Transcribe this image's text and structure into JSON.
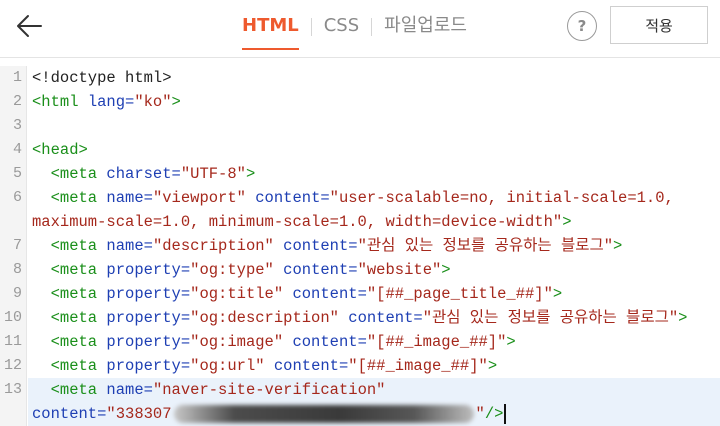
{
  "toolbar": {
    "tabs": [
      {
        "label": "HTML",
        "active": true
      },
      {
        "label": "CSS",
        "active": false
      },
      {
        "label": "파일업로드",
        "active": false
      }
    ],
    "help_label": "?",
    "apply_label": "적용",
    "accent_color": "#ee5a2e"
  },
  "editor": {
    "lines": [
      {
        "num": "1",
        "tokens": [
          {
            "t": "plain",
            "v": "<!doctype html>"
          }
        ]
      },
      {
        "num": "2",
        "tokens": [
          {
            "t": "tag",
            "v": "<html "
          },
          {
            "t": "attr",
            "v": "lang="
          },
          {
            "t": "str",
            "v": "\"ko\""
          },
          {
            "t": "tag",
            "v": ">"
          }
        ]
      },
      {
        "num": "3",
        "tokens": []
      },
      {
        "num": "4",
        "tokens": [
          {
            "t": "tag",
            "v": "<head>"
          }
        ]
      },
      {
        "num": "5",
        "tokens": [
          {
            "t": "tag",
            "v": "  <meta "
          },
          {
            "t": "attr",
            "v": "charset="
          },
          {
            "t": "str",
            "v": "\"UTF-8\""
          },
          {
            "t": "tag",
            "v": ">"
          }
        ]
      },
      {
        "num": "6",
        "tokens": [
          {
            "t": "tag",
            "v": "  <meta "
          },
          {
            "t": "attr",
            "v": "name="
          },
          {
            "t": "str",
            "v": "\"viewport\""
          },
          {
            "t": "attr",
            "v": " content="
          },
          {
            "t": "str",
            "v": "\"user-scalable=no, initial-scale=1.0,"
          }
        ]
      },
      {
        "num": "",
        "tokens": [
          {
            "t": "str",
            "v": "maximum-scale=1.0, minimum-scale=1.0, width=device-width\""
          },
          {
            "t": "tag",
            "v": ">"
          }
        ]
      },
      {
        "num": "7",
        "tokens": [
          {
            "t": "tag",
            "v": "  <meta "
          },
          {
            "t": "attr",
            "v": "name="
          },
          {
            "t": "str",
            "v": "\"description\""
          },
          {
            "t": "attr",
            "v": " content="
          },
          {
            "t": "str",
            "v": "\"관심 있는 정보를 공유하는 블로그\""
          },
          {
            "t": "tag",
            "v": ">"
          }
        ]
      },
      {
        "num": "8",
        "tokens": [
          {
            "t": "tag",
            "v": "  <meta "
          },
          {
            "t": "attr",
            "v": "property="
          },
          {
            "t": "str",
            "v": "\"og:type\""
          },
          {
            "t": "attr",
            "v": " content="
          },
          {
            "t": "str",
            "v": "\"website\""
          },
          {
            "t": "tag",
            "v": ">"
          }
        ]
      },
      {
        "num": "9",
        "tokens": [
          {
            "t": "tag",
            "v": "  <meta "
          },
          {
            "t": "attr",
            "v": "property="
          },
          {
            "t": "str",
            "v": "\"og:title\""
          },
          {
            "t": "attr",
            "v": " content="
          },
          {
            "t": "str",
            "v": "\"[##_page_title_##]\""
          },
          {
            "t": "tag",
            "v": ">"
          }
        ]
      },
      {
        "num": "10",
        "tokens": [
          {
            "t": "tag",
            "v": "  <meta "
          },
          {
            "t": "attr",
            "v": "property="
          },
          {
            "t": "str",
            "v": "\"og:description\""
          },
          {
            "t": "attr",
            "v": " content="
          },
          {
            "t": "str",
            "v": "\"관심 있는 정보를 공유하는 블로그\""
          },
          {
            "t": "tag",
            "v": ">"
          }
        ]
      },
      {
        "num": "11",
        "tokens": [
          {
            "t": "tag",
            "v": "  <meta "
          },
          {
            "t": "attr",
            "v": "property="
          },
          {
            "t": "str",
            "v": "\"og:image\""
          },
          {
            "t": "attr",
            "v": " content="
          },
          {
            "t": "str",
            "v": "\"[##_image_##]\""
          },
          {
            "t": "tag",
            "v": ">"
          }
        ]
      },
      {
        "num": "12",
        "tokens": [
          {
            "t": "tag",
            "v": "  <meta "
          },
          {
            "t": "attr",
            "v": "property="
          },
          {
            "t": "str",
            "v": "\"og:url\""
          },
          {
            "t": "attr",
            "v": " content="
          },
          {
            "t": "str",
            "v": "\"[##_image_##]\""
          },
          {
            "t": "tag",
            "v": ">"
          }
        ]
      },
      {
        "num": "13",
        "tokens": [
          {
            "t": "tag",
            "v": "  <meta "
          },
          {
            "t": "attr",
            "v": "name="
          },
          {
            "t": "str",
            "v": "\"naver-site-verification\""
          }
        ]
      },
      {
        "num": "",
        "tokens": [
          {
            "t": "attr",
            "v": "content="
          },
          {
            "t": "str",
            "v": "\"338307"
          },
          {
            "t": "redacted",
            "v": ""
          },
          {
            "t": "str",
            "v": "\""
          },
          {
            "t": "tag",
            "v": "/>"
          },
          {
            "t": "caret",
            "v": ""
          }
        ]
      }
    ]
  }
}
